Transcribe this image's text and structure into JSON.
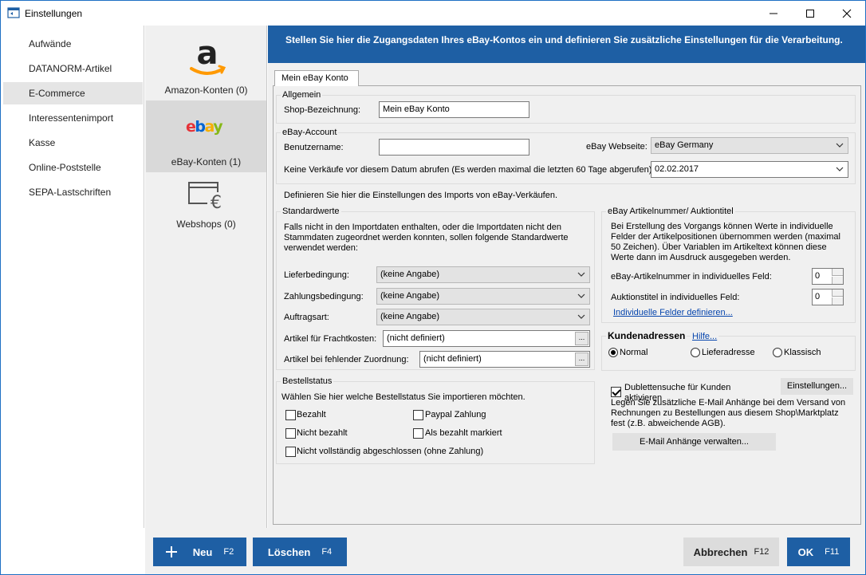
{
  "window": {
    "title": "Einstellungen"
  },
  "nav": {
    "items": [
      {
        "label": "Aufwände"
      },
      {
        "label": "DATANORM-Artikel"
      },
      {
        "label": "E-Commerce",
        "active": true
      },
      {
        "label": "Interessentenimport"
      },
      {
        "label": "Kasse"
      },
      {
        "label": "Online-Poststelle"
      },
      {
        "label": "SEPA-Lastschriften"
      }
    ]
  },
  "accounts": {
    "amazon": {
      "label": "Amazon-Konten (0)",
      "icon": "amazon-logo-icon"
    },
    "ebay": {
      "label": "eBay-Konten (1)",
      "icon": "ebay-logo-icon",
      "logo_text": "ebay"
    },
    "webshops": {
      "label": "Webshops (0)",
      "icon": "webshop-euro-icon"
    }
  },
  "banner": {
    "text": "Stellen Sie hier die Zugangsdaten Ihres eBay-Kontos ein und definieren Sie zusätzliche Einstellungen für die Verarbeitung."
  },
  "tab": {
    "label": "Mein eBay Konto"
  },
  "allgemein": {
    "title": "Allgemein",
    "shop_label": "Shop-Bezeichnung:",
    "shop_value": "Mein eBay Konto"
  },
  "account": {
    "title": "eBay-Account",
    "user_label": "Benutzername:",
    "user_value": "",
    "website_label": "eBay Webseite:",
    "website_value": "eBay Germany",
    "date_label": "Keine Verkäufe vor diesem Datum abrufen (Es werden maximal die letzten 60 Tage abgerufen):",
    "date_value": "02.02.2017"
  },
  "import_heading": "Definieren Sie hier die Einstellungen des Imports von eBay-Verkäufen.",
  "standard": {
    "title": "Standardwerte",
    "description": "Falls nicht in den Importdaten enthalten, oder die Importdaten nicht den Stammdaten zugeordnet werden konnten, sollen folgende Standardwerte verwendet werden:",
    "liefer_label": "Lieferbedingung:",
    "liefer_value": "(keine Angabe)",
    "zahlung_label": "Zahlungsbedingung:",
    "zahlung_value": "(keine Angabe)",
    "auftrag_label": "Auftragsart:",
    "auftrag_value": "(keine Angabe)",
    "fracht_label": "Artikel für Frachtkosten:",
    "fracht_value": "(nicht definiert)",
    "fehlend_label": "Artikel bei fehlender Zuordnung:",
    "fehlend_value": "(nicht definiert)",
    "ellipsis": "..."
  },
  "bestellstatus": {
    "title": "Bestellstatus",
    "description": "Wählen Sie hier welche Bestellstatus Sie importieren möchten.",
    "options": [
      {
        "label": "Bezahlt",
        "checked": false
      },
      {
        "label": "Paypal Zahlung",
        "checked": false
      },
      {
        "label": "Nicht bezahlt",
        "checked": false
      },
      {
        "label": "Als bezahlt markiert",
        "checked": false
      },
      {
        "label": "Nicht vollständig abgeschlossen (ohne Zahlung)",
        "checked": false
      }
    ]
  },
  "artikel": {
    "title": "eBay Artikelnummer/ Auktiontitel",
    "description": "Bei Erstellung des Vorgangs können Werte in individuelle Felder der Artikelpositionen übernommen werden (maximal 50 Zeichen). Über Variablen im Artikeltext können diese Werte dann im Ausdruck ausgegeben werden.",
    "artnr_label": "eBay-Artikelnummer in individuelles Feld:",
    "artnr_value": "0",
    "titel_label": "Auktionstitel in individuelles Feld:",
    "titel_value": "0",
    "link": "Individuelle Felder definieren..."
  },
  "kunden": {
    "title": "Kundenadressen",
    "help": "Hilfe...",
    "options": [
      {
        "label": "Normal",
        "selected": true
      },
      {
        "label": "Lieferadresse",
        "selected": false
      },
      {
        "label": "Klassisch",
        "selected": false
      }
    ]
  },
  "dubletten": {
    "label": "Dublettensuche für Kunden aktivieren",
    "checked": true,
    "button": "Einstellungen..."
  },
  "email": {
    "description": "Legen Sie zusätzliche E-Mail Anhänge bei dem Versand von Rechnungen zu Bestellungen aus diesem Shop\\Marktplatz fest (z.B. abweichende AGB).",
    "button": "E-Mail Anhänge verwalten..."
  },
  "footer": {
    "new_label": "Neu",
    "new_key": "F2",
    "delete_label": "Löschen",
    "delete_key": "F4",
    "cancel_label": "Abbrechen",
    "cancel_key": "F12",
    "ok_label": "OK",
    "ok_key": "F11"
  },
  "colors": {
    "accent": "#1e5fa4",
    "panel": "#f0f0f0",
    "amazon_orange": "#ff9900"
  }
}
